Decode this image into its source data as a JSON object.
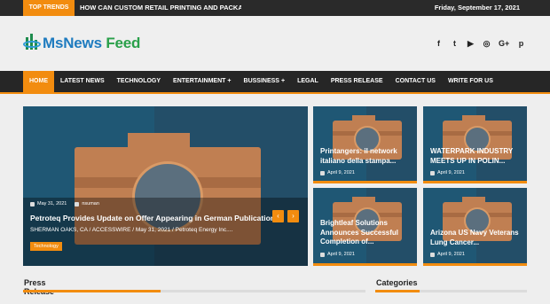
{
  "topbar": {
    "trend_label": "TOP TRENDS",
    "trend_text": "HOW CAN CUSTOM RETAIL PRINTING AND PACKAGING",
    "date": "Friday, September 17, 2021"
  },
  "header": {
    "logo_ms": "MsNews",
    "logo_feed": " Feed",
    "socials": [
      "facebook-icon",
      "twitter-icon",
      "youtube-icon",
      "instagram-icon",
      "google-plus-icon",
      "pinterest-icon"
    ],
    "social_glyphs": [
      "f",
      "t",
      "▶",
      "◎",
      "G+",
      "p"
    ]
  },
  "nav": {
    "items": [
      {
        "label": "HOME",
        "active": true
      },
      {
        "label": "LATEST NEWS"
      },
      {
        "label": "TECHNOLOGY"
      },
      {
        "label": "ENTERTAINMENT",
        "dropdown": true
      },
      {
        "label": "BUSSINESS",
        "dropdown": true
      },
      {
        "label": "LEGAL"
      },
      {
        "label": "PRESS RELEASE"
      },
      {
        "label": "CONTACT US"
      },
      {
        "label": "WRITE FOR US"
      }
    ]
  },
  "hero": {
    "date": "May 31, 2021",
    "author": "nsuman",
    "title": "Petroteq Provides Update on Offer Appearing in German Publication",
    "excerpt": "SHERMAN OAKS, CA / ACCESSWIRE / May 31, 2021 / Petroteq Energy Inc....",
    "tag": "Technology",
    "prev": "‹",
    "next": "›"
  },
  "tiles": [
    {
      "title": "Printangers: il network italiano della stampa...",
      "date": "April 9, 2021"
    },
    {
      "title": "WATERPARK INDUSTRY MEETS UP IN POLIN...",
      "date": "April 9, 2021"
    },
    {
      "title": "Brightleaf Solutions Announces Successful Completion of...",
      "date": "April 9, 2021"
    },
    {
      "title": "Arizona US Navy Veterans Lung Cancer...",
      "date": "April 9, 2021"
    }
  ],
  "sections": {
    "press_release": "Press Release",
    "categories": "Categories"
  },
  "colors": {
    "accent": "#f28c0f",
    "dark": "#262626",
    "tile_bg": "#1f5774"
  }
}
